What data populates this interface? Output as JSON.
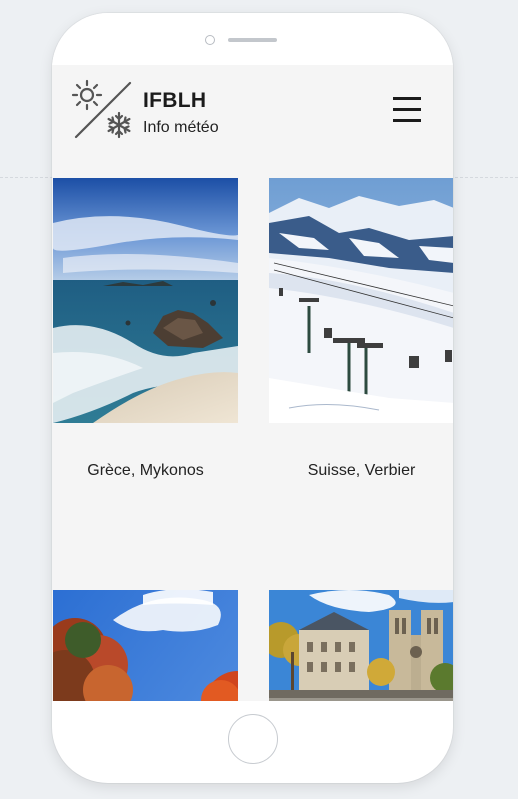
{
  "brand": {
    "title": "IFBLH",
    "subtitle": "Info météo"
  },
  "icons": {
    "logo": "sun-snowflake-icon",
    "menu": "hamburger-menu-icon"
  },
  "destinations": [
    {
      "label": "Grèce, Mykonos",
      "image": "beach-rocks-sea"
    },
    {
      "label": "Suisse, Verbier",
      "image": "snowy-mountain-ski-lift"
    },
    {
      "label": "",
      "image": "autumn-trees-blue-sky"
    },
    {
      "label": "",
      "image": "paris-notre-dame-autumn"
    }
  ],
  "colors": {
    "background": "#edf0f3",
    "screen": "#f5f5f5",
    "text": "#1b1b1b"
  }
}
